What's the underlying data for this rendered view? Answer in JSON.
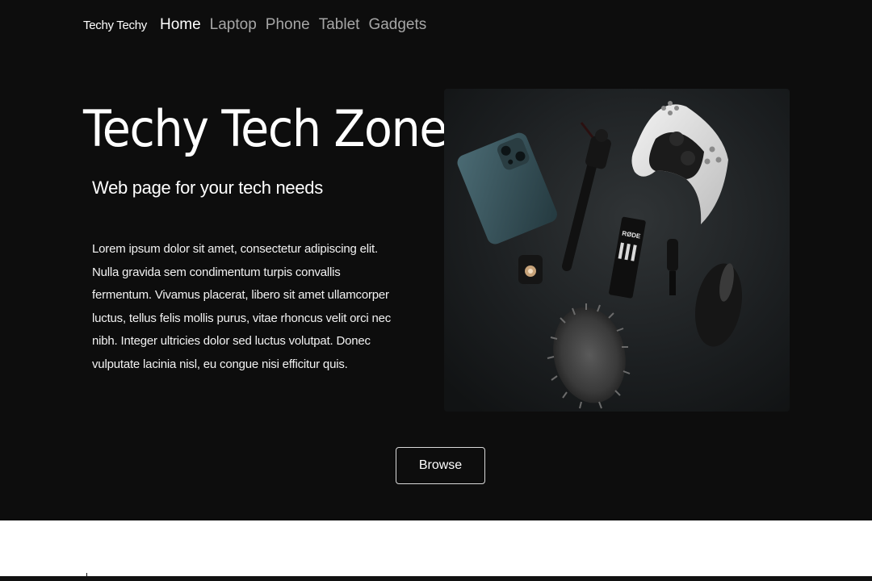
{
  "nav": {
    "brand": "Techy Techy",
    "links": [
      "Home",
      "Laptop",
      "Phone",
      "Tablet",
      "Gadgets"
    ],
    "active": "Home"
  },
  "hero": {
    "title": "Techy Tech Zone",
    "subtitle": "Web page for your tech needs",
    "description": "Lorem ipsum dolor sit amet, consectetur adipiscing elit. Nulla gravida sem condimentum turpis convallis fermentum. Vivamus placerat, libero sit amet ullamcorper luctus, tellus felis mollis purus, vitae rhoncus velit orci nec nibh. Integer ultricies dolor sed luctus volutpat. Donec vulputate lacinia nisl, eu congue nisi efficitur quis.",
    "image_label": "RØDE",
    "button_label": "Browse"
  },
  "colors": {
    "hero_background": "#0d0d0d",
    "text": "#ffffff",
    "nav_inactive": "#a6a6a6",
    "page_background": "#ffffff"
  }
}
